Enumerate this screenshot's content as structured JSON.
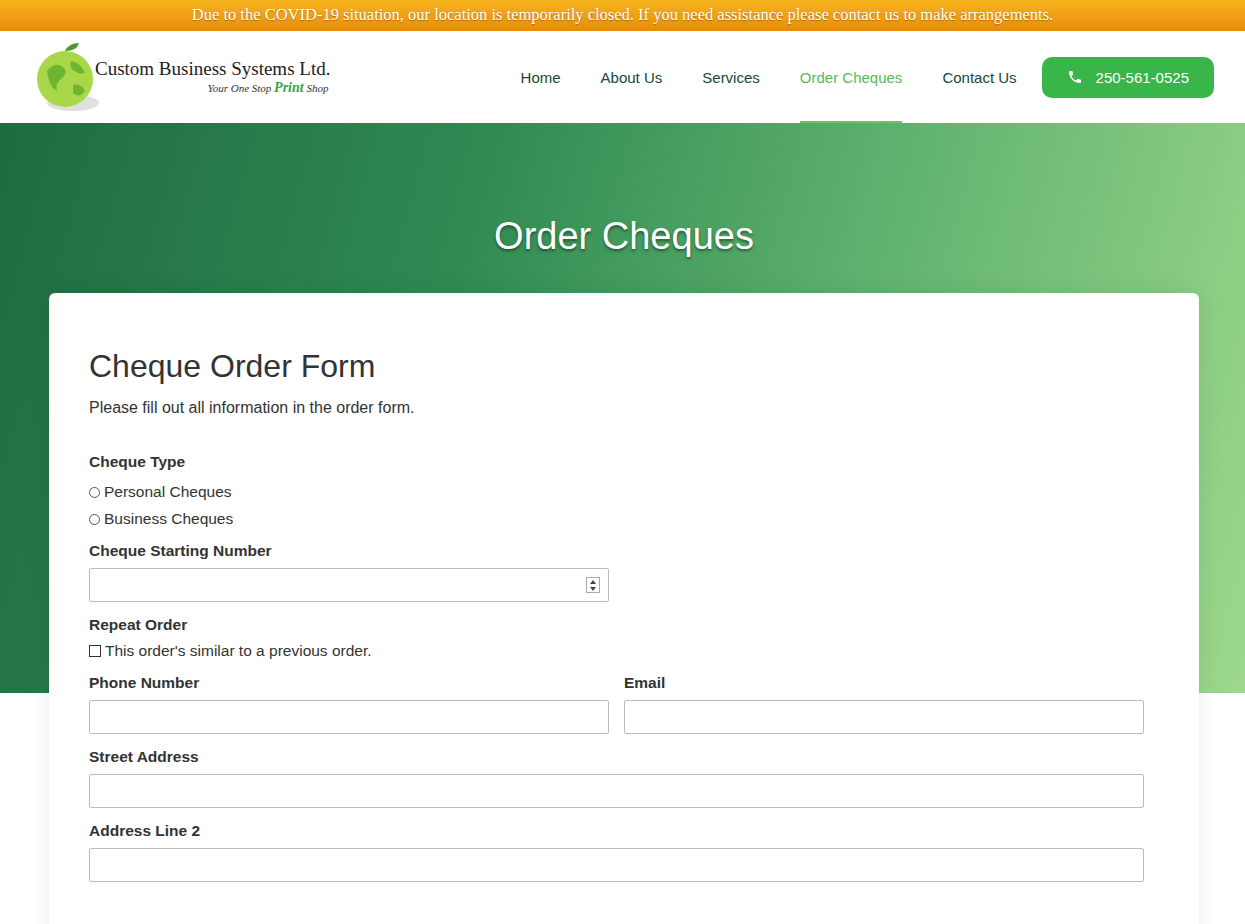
{
  "banner": "Due to the COVID-19 situation, our location is temporarily closed. If you need assistance please contact us to make arrangements.",
  "logo": {
    "name": "Custom Business Systems Ltd.",
    "tagline_before": "Your One Stop",
    "tagline_highlight": "Print",
    "tagline_after": "Shop"
  },
  "nav": [
    {
      "label": "Home",
      "selected": false
    },
    {
      "label": "About Us",
      "selected": false
    },
    {
      "label": "Services",
      "selected": false
    },
    {
      "label": "Order Cheques",
      "selected": true
    },
    {
      "label": "Contact Us",
      "selected": false
    }
  ],
  "phone_button": "250-561-0525",
  "hero": {
    "title": "Order Cheques"
  },
  "form": {
    "title": "Cheque Order Form",
    "intro": "Please fill out all information in the order form.",
    "fields": [
      {
        "kind": "radio",
        "label": "Cheque Type",
        "options": [
          {
            "label": "Personal Cheques",
            "selected": false
          },
          {
            "label": "Business Cheques",
            "selected": false
          }
        ]
      },
      {
        "kind": "number",
        "label": "Cheque Starting Number",
        "value": ""
      },
      {
        "kind": "checkbox",
        "label": "Repeat Order",
        "text": "This order's similar to a previous order.",
        "checked": false
      },
      {
        "kind": "row",
        "fields": [
          {
            "label": "Phone Number",
            "value": ""
          },
          {
            "label": "Email",
            "value": ""
          }
        ]
      },
      {
        "kind": "text",
        "label": "Street Address",
        "value": ""
      },
      {
        "kind": "text",
        "label": "Address Line 2",
        "value": ""
      }
    ]
  }
}
